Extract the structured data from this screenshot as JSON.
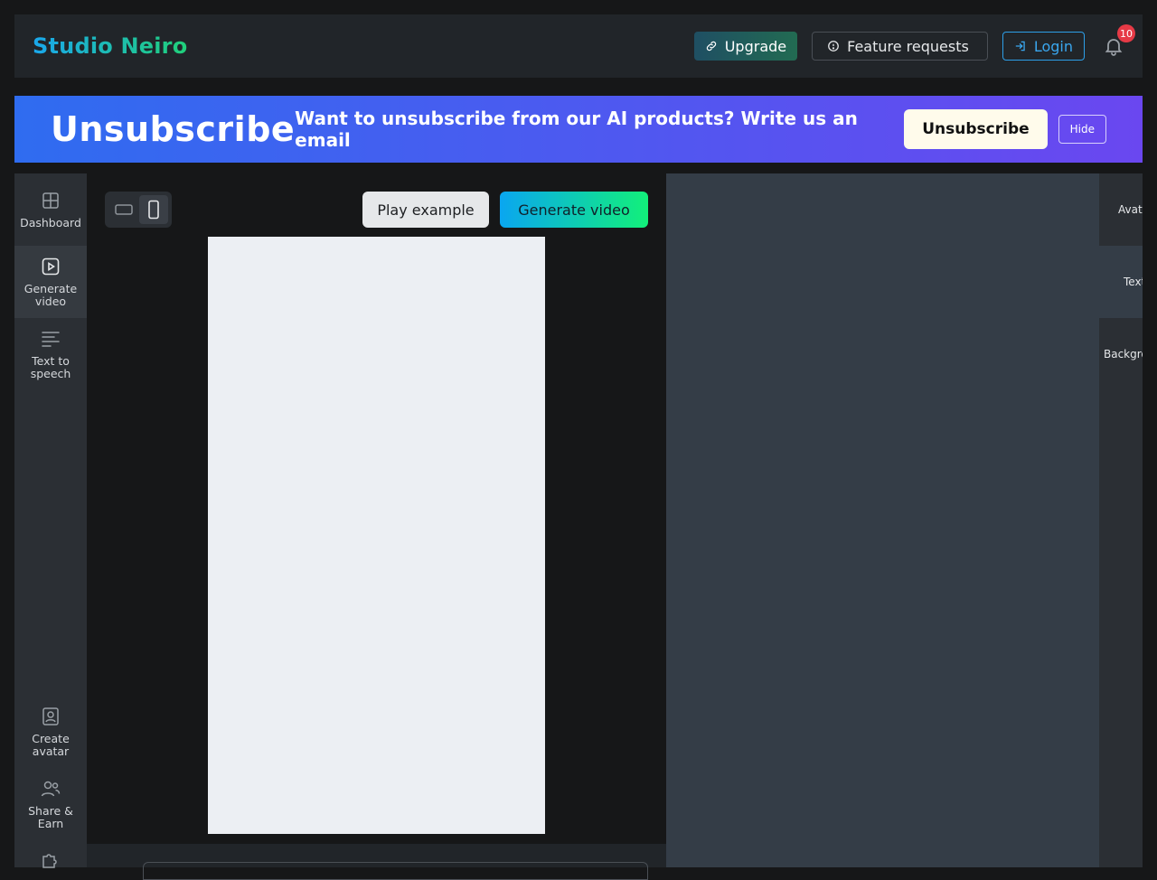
{
  "header": {
    "brand": "Studio Neiro",
    "upgrade_label": "Upgrade",
    "feature_label": "Feature requests",
    "login_label": "Login",
    "notification_count": "10"
  },
  "banner": {
    "title": "Unsubscribe",
    "text": "Want to unsubscribe from our AI products? Write us an email",
    "unsubscribe_label": "Unsubscribe",
    "hide_label": "Hide"
  },
  "sidebar": {
    "items": [
      {
        "label": "Dashboard"
      },
      {
        "label": "Generate video"
      },
      {
        "label": "Text to speech"
      },
      {
        "label": "Create avatar"
      },
      {
        "label": "Share & Earn"
      }
    ]
  },
  "toolbar": {
    "play_label": "Play example",
    "generate_label": "Generate video"
  },
  "right_tabs": {
    "items": [
      {
        "label": "Avatar"
      },
      {
        "label": "Text"
      },
      {
        "label": "Background"
      }
    ]
  },
  "colors": {
    "accent_blue": "#1aa7ec",
    "accent_green": "#20d07a",
    "badge_red": "#e63a46",
    "banner_start": "#2f6cf0",
    "banner_end": "#6a47f0"
  }
}
